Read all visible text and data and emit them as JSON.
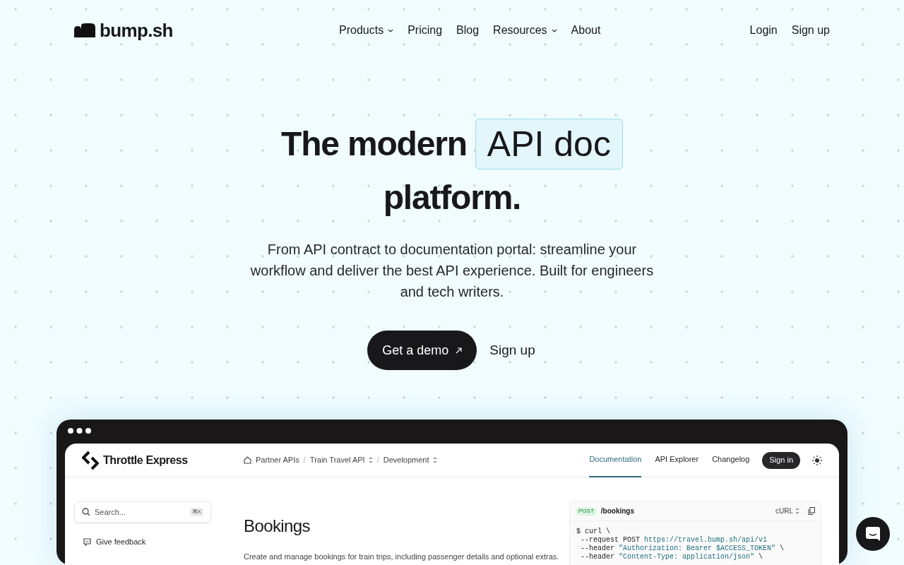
{
  "nav": {
    "logo": "bump.sh",
    "items": [
      {
        "label": "Products",
        "dropdown": true
      },
      {
        "label": "Pricing",
        "dropdown": false
      },
      {
        "label": "Blog",
        "dropdown": false
      },
      {
        "label": "Resources",
        "dropdown": true
      },
      {
        "label": "About",
        "dropdown": false
      }
    ],
    "auth": [
      "Login",
      "Sign up"
    ]
  },
  "hero": {
    "title_before": "The modern",
    "highlight": "API doc",
    "title_after": "platform.",
    "subtitle": "From API contract to documentation portal: streamline your workflow and deliver the best API experience. Built for engineers and tech writers.",
    "primary_button": "Get a demo",
    "secondary_button": "Sign up"
  },
  "preview": {
    "brand": "Throttle Express",
    "breadcrumb_separator": "/",
    "breadcrumbs": [
      {
        "label": "Partner APIs",
        "switcher": false
      },
      {
        "label": "Train Travel API",
        "switcher": true
      },
      {
        "label": "Development",
        "switcher": true
      }
    ],
    "tabs": [
      {
        "label": "Documentation",
        "selected": true
      },
      {
        "label": "API Explorer",
        "selected": false
      },
      {
        "label": "Changelog",
        "selected": false
      }
    ],
    "sign_in": "Sign in",
    "search": {
      "placeholder": "Search...",
      "shortcut": "⌘K"
    },
    "feedback": "Give feedback",
    "heading": "Bookings",
    "description": "Create and manage bookings for train trips, including passenger details and optional extras.",
    "code": {
      "method": "POST",
      "path": "/bookings",
      "language": "cURL",
      "lines": [
        [
          {
            "text": "$ curl \\",
            "kind": "plain"
          }
        ],
        [
          {
            "text": " --request POST ",
            "kind": "plain"
          },
          {
            "text": "https://travel.bump.sh/api/v1",
            "kind": "string"
          }
        ],
        [
          {
            "text": " --header ",
            "kind": "plain"
          },
          {
            "text": "\"Authorization: Bearer $ACCESS_TOKEN\"",
            "kind": "string"
          },
          {
            "text": " \\",
            "kind": "plain"
          }
        ],
        [
          {
            "text": " --header ",
            "kind": "plain"
          },
          {
            "text": "\"Content-Type: application/json\"",
            "kind": "string"
          },
          {
            "text": " \\",
            "kind": "plain"
          }
        ]
      ]
    }
  }
}
